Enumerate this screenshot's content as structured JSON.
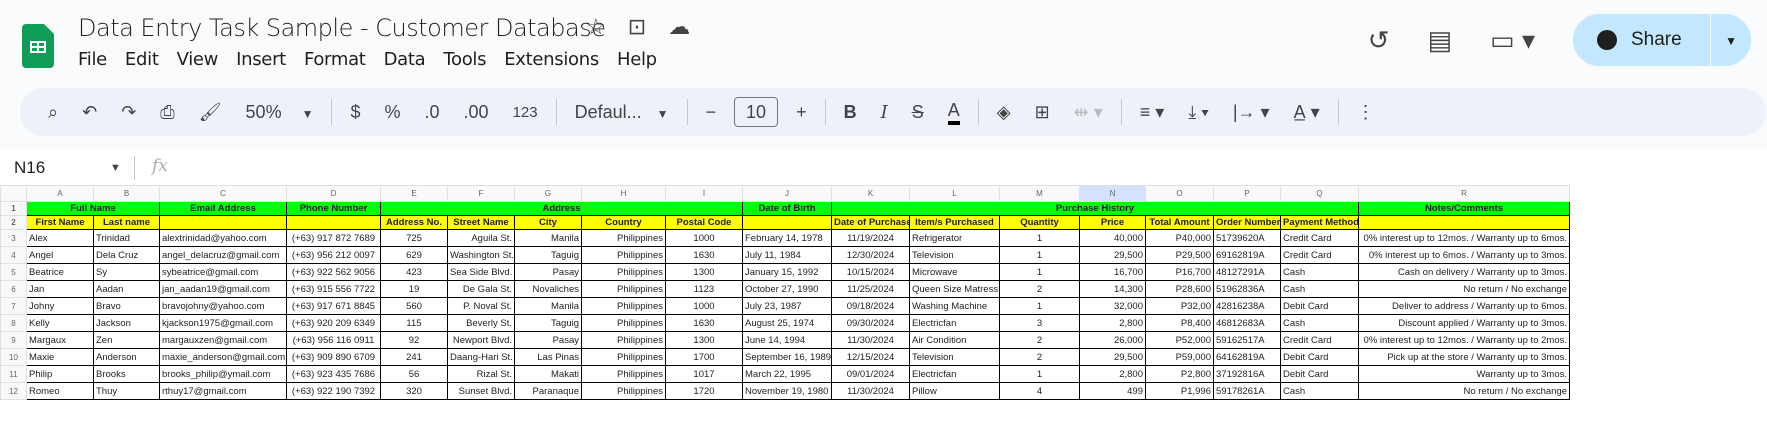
{
  "app": {
    "title": "Data Entry Task Sample - Customer Database",
    "share_label": "Share",
    "menu": [
      "File",
      "Edit",
      "View",
      "Insert",
      "Format",
      "Data",
      "Tools",
      "Extensions",
      "Help"
    ],
    "toolbar": {
      "zoom": "50%",
      "currency": "$",
      "percent": "%",
      "dec_decrease": ".0",
      "dec_increase": ".00",
      "number_format": "123",
      "font": "Defaul...",
      "font_size": "10",
      "minus": "−",
      "plus": "+"
    },
    "name_box": "N16",
    "fx": "fx"
  },
  "columns": [
    "A",
    "B",
    "C",
    "D",
    "E",
    "F",
    "G",
    "H",
    "I",
    "J",
    "K",
    "L",
    "M",
    "N",
    "O",
    "P",
    "Q",
    "R"
  ],
  "selected_column": "N",
  "header_row1": [
    {
      "label": "Full Name",
      "span": 2
    },
    {
      "label": "Email Address",
      "span": 1
    },
    {
      "label": "Phone Number",
      "span": 1
    },
    {
      "label": "Address",
      "span": 5
    },
    {
      "label": "Date of Birth",
      "span": 1
    },
    {
      "label": "Purchase History",
      "span": 7
    },
    {
      "label": "Notes/Comments",
      "span": 1
    }
  ],
  "header_row2": [
    "First Name",
    "Last name",
    "",
    "",
    "Address No.",
    "Street Name",
    "City",
    "Country",
    "Postal Code",
    "",
    "Date of Purchase",
    "Item/s Purchased",
    "Quantity",
    "Price",
    "Total Amount",
    "Order Number",
    "Payment Method",
    ""
  ],
  "rows": [
    [
      "Alex",
      "Trinidad",
      "alextrinidad@yahoo.com",
      "(+63) 917 872 7689",
      "725",
      "Aguila St.",
      "Manila",
      "Philippines",
      "1000",
      "February 14, 1978",
      "11/19/2024",
      "Refrigerator",
      "1",
      "40,000",
      "P40,000",
      "51739620A",
      "Credit Card",
      "0% interest up to 12mos. / Warranty up to 6mos."
    ],
    [
      "Angel",
      "Dela Cruz",
      "angel_delacruz@gmail.com",
      "(+63) 956 212 0097",
      "629",
      "Washington St.",
      "Taguig",
      "Philippines",
      "1630",
      "July 11, 1984",
      "12/30/2024",
      "Television",
      "1",
      "29,500",
      "P29,500",
      "69162819A",
      "Credit Card",
      "0% interest up to 6mos. / Warranty up to 3mos."
    ],
    [
      "Beatrice",
      "Sy",
      "sybeatrice@gmail.com",
      "(+63) 922 562 9056",
      "423",
      "Sea Side Blvd.",
      "Pasay",
      "Philippines",
      "1300",
      "January 15, 1992",
      "10/15/2024",
      "Microwave",
      "1",
      "16,700",
      "P16,700",
      "48127291A",
      "Cash",
      "Cash on delivery / Warranty up to 3mos."
    ],
    [
      "Jan",
      "Aadan",
      "jan_aadan19@gmail.com",
      "(+63) 915 556 7722",
      "19",
      "De Gala St.",
      "Novaliches",
      "Philippines",
      "1123",
      "October 27, 1990",
      "11/25/2024",
      "Queen Size Matress",
      "2",
      "14,300",
      "P28,600",
      "51962836A",
      "Cash",
      "No return / No exchange"
    ],
    [
      "Johny",
      "Bravo",
      "bravojohny@yahoo.com",
      "(+63) 917 671 8845",
      "560",
      "P. Noval St.",
      "Manila",
      "Philippines",
      "1000",
      "July 23, 1987",
      "09/18/2024",
      "Washing Machine",
      "1",
      "32,000",
      "P32,00",
      "42816238A",
      "Debit Card",
      "Deliver to address / Warranty up to 6mos."
    ],
    [
      "Kelly",
      "Jackson",
      "kjackson1975@gmail.com",
      "(+63) 920 209 6349",
      "115",
      "Beverly St.",
      "Taguig",
      "Philippines",
      "1630",
      "August 25, 1974",
      "09/30/2024",
      "Electricfan",
      "3",
      "2,800",
      "P8,400",
      "46812683A",
      "Cash",
      "Discount applied / Warranty up to 3mos."
    ],
    [
      "Margaux",
      "Zen",
      "margauxzen@gmail.com",
      "(+63) 956 116 0911",
      "92",
      "Newport Blvd.",
      "Pasay",
      "Philippines",
      "1300",
      "June 14, 1994",
      "11/30/2024",
      "Air Condition",
      "2",
      "26,000",
      "P52,000",
      "59162517A",
      "Credit Card",
      "0% interest up to 12mos.  / Warranty up to 2mos."
    ],
    [
      "Maxie",
      "Anderson",
      "maxie_anderson@gmail.com",
      "(+63) 909 890 6709",
      "241",
      "Daang-Hari St.",
      "Las Pinas",
      "Philippines",
      "1700",
      "September 16, 1989",
      "12/15/2024",
      "Television",
      "2",
      "29,500",
      "P59,000",
      "64162819A",
      "Debit Card",
      "Pick up at the store / Warranty up to 3mos."
    ],
    [
      "Philip",
      "Brooks",
      "brooks_philip@ymail.com",
      "(+63) 923 435 7686",
      "56",
      "Rizal St.",
      "Makati",
      "Philippines",
      "1017",
      "March 22, 1995",
      "09/01/2024",
      "Electricfan",
      "1",
      "2,800",
      "P2,800",
      "37192816A",
      "Debit Card",
      "Warranty up to 3mos."
    ],
    [
      "Romeo",
      "Thuy",
      "rthuy17@gmail.com",
      "(+63) 922 190 7392",
      "320",
      "Sunset Blvd.",
      "Paranaque",
      "Philippines",
      "1720",
      "November 19, 1980",
      "11/30/2024",
      "Pillow",
      "4",
      "499",
      "P1,996",
      "59178261A",
      "Cash",
      "No return / No exchange"
    ]
  ],
  "colors": {
    "group_header": "#00ff00",
    "sub_header": "#ffff00",
    "share_bg": "#c2e7ff"
  }
}
